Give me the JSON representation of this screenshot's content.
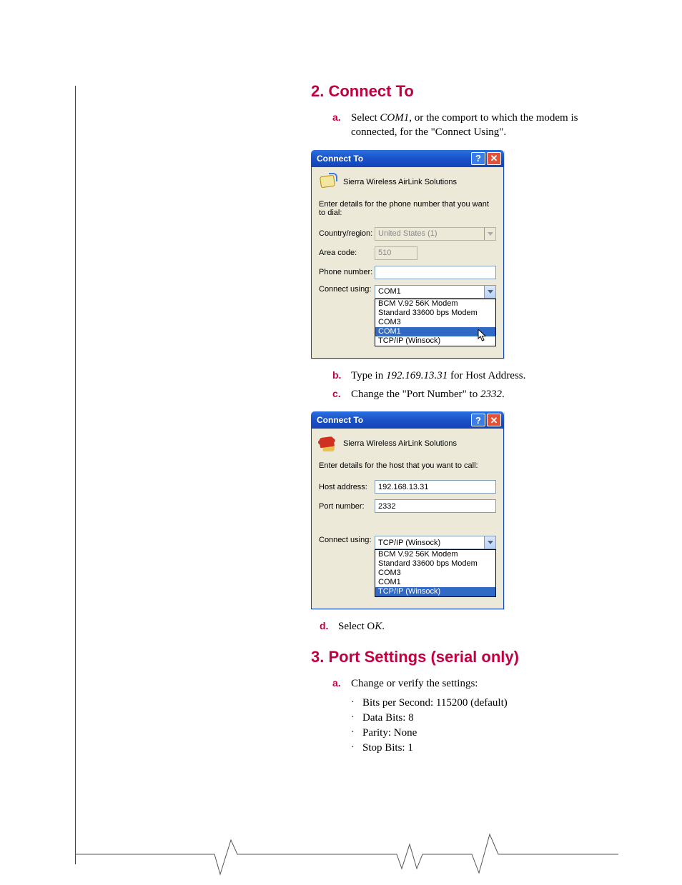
{
  "section2": {
    "heading": "2. Connect To",
    "a": {
      "marker": "a.",
      "pre": "Select ",
      "it": "COM1",
      "post": ", or the comport to which the modem is connected, for the \"Connect Using\"."
    },
    "b": {
      "marker": "b.",
      "pre": "Type in ",
      "it": "192.169.13.31",
      "post": " for Host Address."
    },
    "c": {
      "marker": "c.",
      "pre": "Change the \"Port Number\" to ",
      "it": "2332",
      "post": "."
    },
    "d": {
      "marker": "d.",
      "pre": "Select O",
      "it": "K",
      "post": "."
    }
  },
  "dialog1": {
    "title": "Connect To",
    "product": "Sierra Wireless AirLink Solutions",
    "prompt": "Enter details for the phone number that you want to dial:",
    "labels": {
      "country": "Country/region:",
      "area": "Area code:",
      "phone": "Phone number:",
      "connect": "Connect using:"
    },
    "values": {
      "country": "United States (1)",
      "area": "510",
      "phone": "",
      "connect": "COM1"
    },
    "options": [
      "BCM V.92 56K Modem",
      "Standard 33600 bps Modem",
      "COM3",
      "COM1",
      "TCP/IP (Winsock)"
    ],
    "highlight_index": 3
  },
  "dialog2": {
    "title": "Connect To",
    "product": "Sierra Wireless AirLink Solutions",
    "prompt": "Enter details for the host that you want to call:",
    "labels": {
      "host": "Host address:",
      "port": "Port number:",
      "connect": "Connect using:"
    },
    "values": {
      "host": "192.168.13.31",
      "port": "2332",
      "connect": "TCP/IP (Winsock)"
    },
    "options": [
      "BCM V.92 56K Modem",
      "Standard 33600 bps Modem",
      "COM3",
      "COM1",
      "TCP/IP (Winsock)"
    ],
    "highlight_index": 4
  },
  "section3": {
    "heading": "3. Port Settings (serial only)",
    "a": {
      "marker": "a.",
      "text": "Change or verify the settings:"
    },
    "bullets": [
      "Bits per Second: 115200 (default)",
      "Data Bits: 8",
      "Parity: None",
      "Stop Bits: 1"
    ]
  }
}
